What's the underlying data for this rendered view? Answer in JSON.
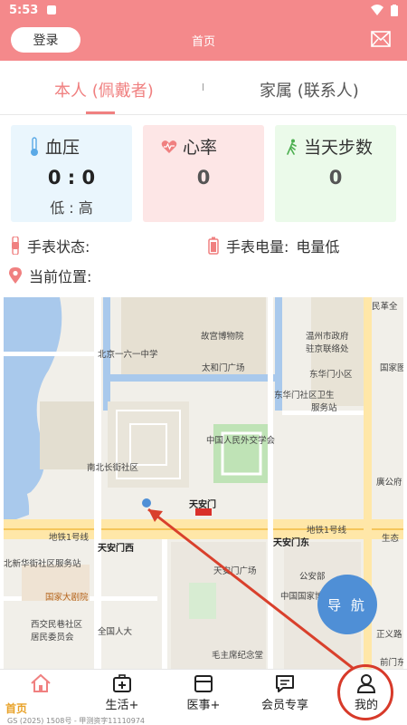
{
  "status_bar": {
    "time": "5:53"
  },
  "header": {
    "login_label": "登录",
    "title": "首页"
  },
  "tabs": [
    {
      "label": "本人 (佩戴者)",
      "active": true
    },
    {
      "label": "家属 (联系人)",
      "active": false
    }
  ],
  "cards": {
    "blood_pressure": {
      "title": "血压",
      "value": "0 : 0",
      "sub": "低 : 高"
    },
    "heart_rate": {
      "title": "心率",
      "value": "0"
    },
    "steps": {
      "title": "当天步数",
      "value": "0"
    }
  },
  "info": {
    "watch_status_label": "手表状态:",
    "battery_label": "手表电量:",
    "battery_value": "电量低",
    "location_label": "当前位置:"
  },
  "map": {
    "labels": [
      {
        "text": "民革全",
        "cls": ""
      },
      {
        "text": "北京一六一中学",
        "cls": ""
      },
      {
        "text": "故宫博物院",
        "cls": ""
      },
      {
        "text": "温州市政府",
        "cls": ""
      },
      {
        "text": "驻京联络处",
        "cls": ""
      },
      {
        "text": "东华门小区",
        "cls": ""
      },
      {
        "text": "国家图",
        "cls": ""
      },
      {
        "text": "太和门广场",
        "cls": ""
      },
      {
        "text": "东华门社区卫生",
        "cls": ""
      },
      {
        "text": "服务站",
        "cls": ""
      },
      {
        "text": "中国人民外交学会",
        "cls": ""
      },
      {
        "text": "南北长街社区",
        "cls": ""
      },
      {
        "text": "天安门",
        "cls": "bold"
      },
      {
        "text": "廣公府",
        "cls": ""
      },
      {
        "text": "地铁1号线",
        "cls": ""
      },
      {
        "text": "地铁1号线",
        "cls": ""
      },
      {
        "text": "天安门西",
        "cls": "bold"
      },
      {
        "text": "天安门东",
        "cls": "bold"
      },
      {
        "text": "生态",
        "cls": ""
      },
      {
        "text": "北新华街社区服务站",
        "cls": ""
      },
      {
        "text": "天安门广场",
        "cls": ""
      },
      {
        "text": "公安部",
        "cls": ""
      },
      {
        "text": "国家大剧院",
        "cls": "brown"
      },
      {
        "text": "中国国家博",
        "cls": ""
      },
      {
        "text": "西交民巷社区",
        "cls": ""
      },
      {
        "text": "居民委员会",
        "cls": ""
      },
      {
        "text": "全国人大",
        "cls": ""
      },
      {
        "text": "正义路",
        "cls": ""
      },
      {
        "text": "毛主席纪念堂",
        "cls": ""
      },
      {
        "text": "前门东",
        "cls": ""
      }
    ],
    "nav_label": "导 航"
  },
  "bottom_nav": {
    "home": "首页",
    "life": "生活+",
    "medical": "医事+",
    "vip": "会员专享",
    "mine": "我的"
  },
  "watermark": "GS (2025) 1508号 - 甲测资字11110974",
  "colors": {
    "primary": "#f4898b",
    "active": "#f08080",
    "nav_button": "#4f8fd6",
    "highlight_circle": "#d73a2a"
  }
}
